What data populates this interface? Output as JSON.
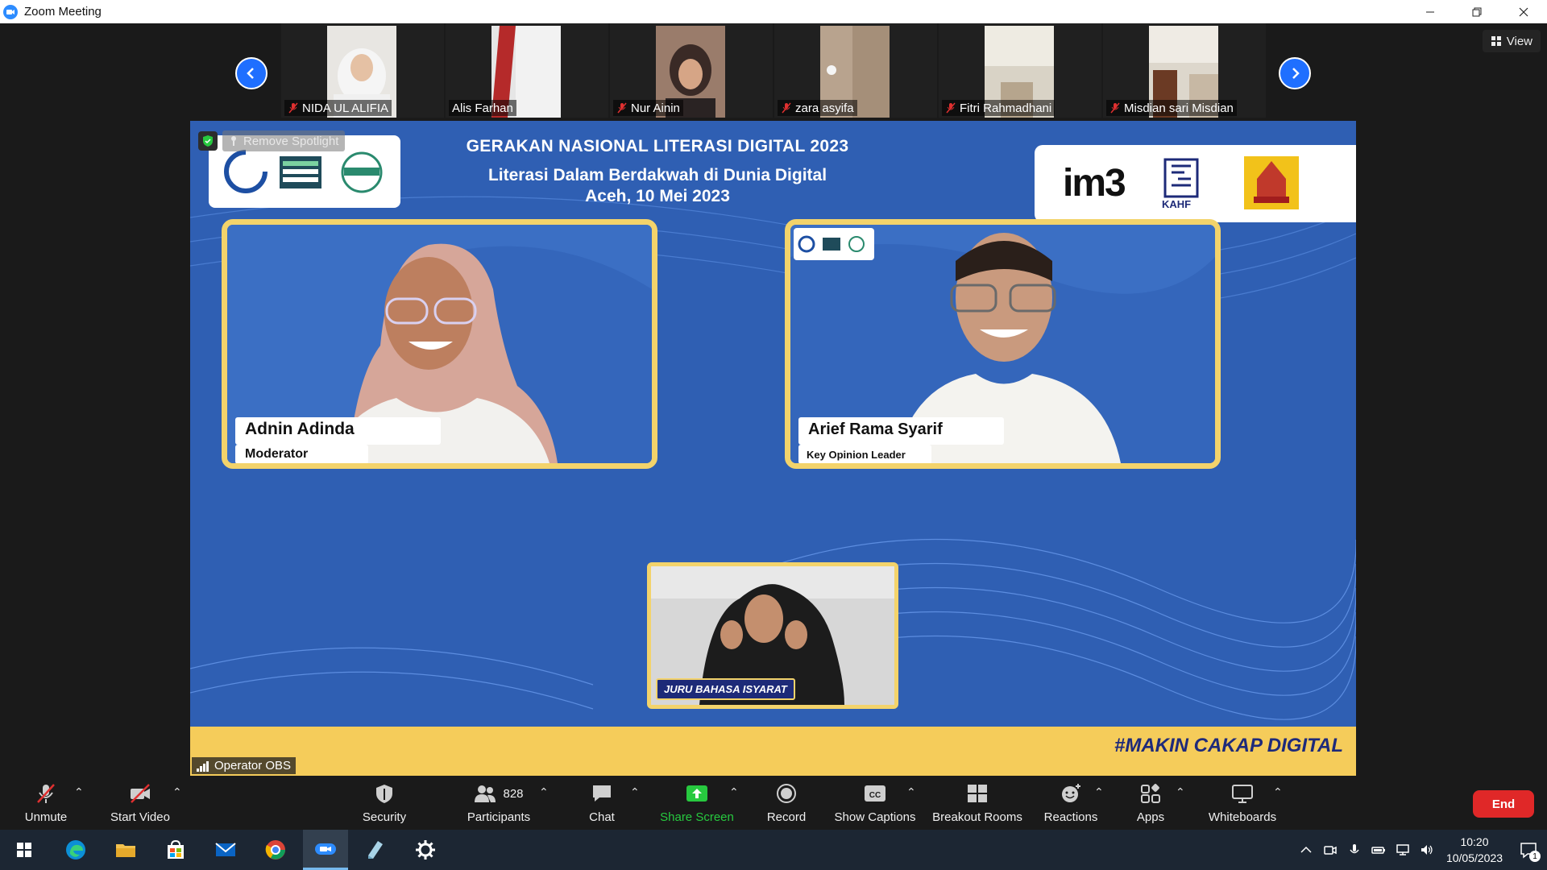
{
  "window": {
    "title": "Zoom Meeting",
    "controls": [
      "minimize",
      "restore",
      "close"
    ]
  },
  "thumbnails": [
    {
      "name": "NIDA UL ALIFIA",
      "muted": true
    },
    {
      "name": "Alis Farhan",
      "muted": false
    },
    {
      "name": "Nur Ainin",
      "muted": true
    },
    {
      "name": "zara asyifa",
      "muted": true
    },
    {
      "name": "Fitri Rahmadhani",
      "muted": true
    },
    {
      "name": "Misdian sari Misdian",
      "muted": true
    }
  ],
  "view_button": {
    "label": "View"
  },
  "spotlight": {
    "label": "Remove Spotlight"
  },
  "share": {
    "headline_1": "GERAKAN NASIONAL LITERASI DIGITAL 2023",
    "headline_2": "Literasi Dalam Berdakwah di Dunia Digital",
    "headline_3": "Aceh, 10 Mei 2023",
    "sponsor_1": "im3",
    "sponsor_2": "KAHF",
    "speaker_left": {
      "name": "Adnin Adinda",
      "role": "Moderator"
    },
    "speaker_right": {
      "name": "Arief Rama Syarif",
      "role": "Key Opinion Leader"
    },
    "interpreter_label": "JURU BAHASA ISYARAT",
    "hashtag": "#MAKIN CAKAP DIGITAL",
    "operator": "Operator OBS"
  },
  "toolbar": {
    "unmute": "Unmute",
    "start_video": "Start Video",
    "security": "Security",
    "participants": "Participants",
    "participants_count": "828",
    "chat": "Chat",
    "share_screen": "Share Screen",
    "record": "Record",
    "show_captions": "Show Captions",
    "breakout_rooms": "Breakout Rooms",
    "reactions": "Reactions",
    "apps": "Apps",
    "whiteboards": "Whiteboards",
    "end": "End"
  },
  "taskbar": {
    "time": "10:20",
    "date": "10/05/2023",
    "notification_count": "1"
  },
  "colors": {
    "zoom_blue": "#2d8cff",
    "share_green": "#27c93f",
    "end_red": "#e02828",
    "banner_yellow": "#f5cc5a",
    "share_bg_blue": "#2f5fb3"
  }
}
